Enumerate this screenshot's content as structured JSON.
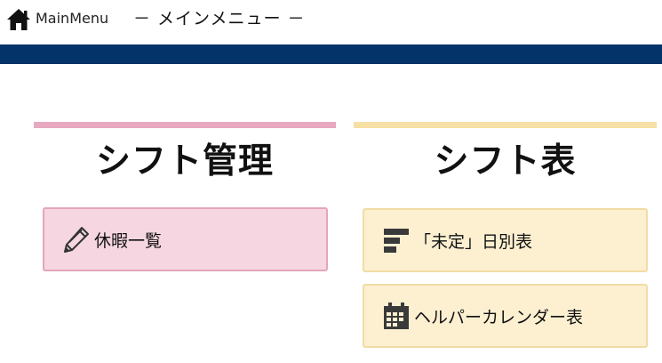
{
  "header": {
    "home_label": "MainMenu",
    "subtitle": "－ メインメニュー －",
    "bar_color": "#04336a"
  },
  "sections": [
    {
      "title": "シフト管理",
      "accent": "#e7a8c0",
      "items": [
        {
          "label": "休暇一覧",
          "icon": "pencil-icon"
        }
      ]
    },
    {
      "title": "シフト表",
      "accent": "#f6e0a6",
      "items": [
        {
          "label": "「未定」日別表",
          "icon": "align-left-bars-icon"
        },
        {
          "label": "ヘルパーカレンダー表",
          "icon": "calendar-icon"
        }
      ]
    }
  ]
}
